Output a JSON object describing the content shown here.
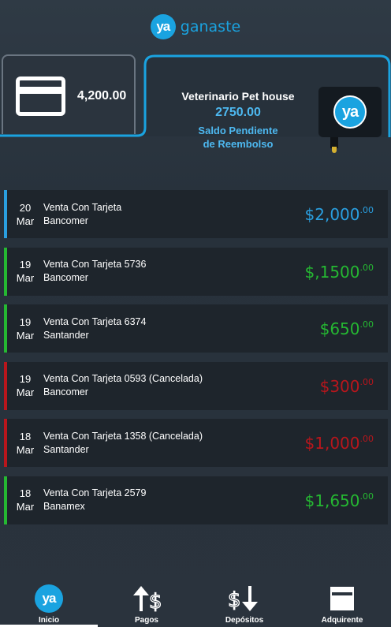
{
  "brand": {
    "badge": "ya",
    "name": "ganaste"
  },
  "card": {
    "amount": "4,200.00"
  },
  "merchant": {
    "name": "Veterinario Pet house",
    "amount": "2750.00",
    "status_line1": "Saldo Pendiente",
    "status_line2": "de Reembolso",
    "terminal_badge": "ya"
  },
  "transactions": [
    {
      "day": "20",
      "month": "Mar",
      "title": "Venta Con Tarjeta",
      "bank": "Bancomer",
      "amount": "$2,000",
      "cents": ".00",
      "color": "#2a9fe0"
    },
    {
      "day": "19",
      "month": "Mar",
      "title": "Venta Con Tarjeta 5736",
      "bank": "Bancomer",
      "amount": "$,1500",
      "cents": ".00",
      "color": "#25b832"
    },
    {
      "day": "19",
      "month": "Mar",
      "title": "Venta Con Tarjeta 6374",
      "bank": "Santander",
      "amount": "$650",
      "cents": ".00",
      "color": "#25b832"
    },
    {
      "day": "19",
      "month": "Mar",
      "title": "Venta Con Tarjeta 0593 (Cancelada)",
      "bank": "Bancomer",
      "amount": "$300",
      "cents": ".00",
      "color": "#b8161c"
    },
    {
      "day": "18",
      "month": "Mar",
      "title": "Venta Con Tarjeta 1358 (Cancelada)",
      "bank": "Santander",
      "amount": "$1,000",
      "cents": ".00",
      "color": "#b8161c"
    },
    {
      "day": "18",
      "month": "Mar",
      "title": "Venta Con Tarjeta 2579",
      "bank": "Banamex",
      "amount": "$1,650",
      "cents": ".00",
      "color": "#25b832"
    }
  ],
  "nav": {
    "inicio": "Inicio",
    "inicio_badge": "ya",
    "pagos": "Pagos",
    "depositos": "Depósitos",
    "adquirente": "Adquirente"
  },
  "colors": {
    "accent": "#1aa3e0",
    "positive": "#25b832",
    "cancelled": "#b8161c",
    "pending": "#2a9fe0"
  }
}
